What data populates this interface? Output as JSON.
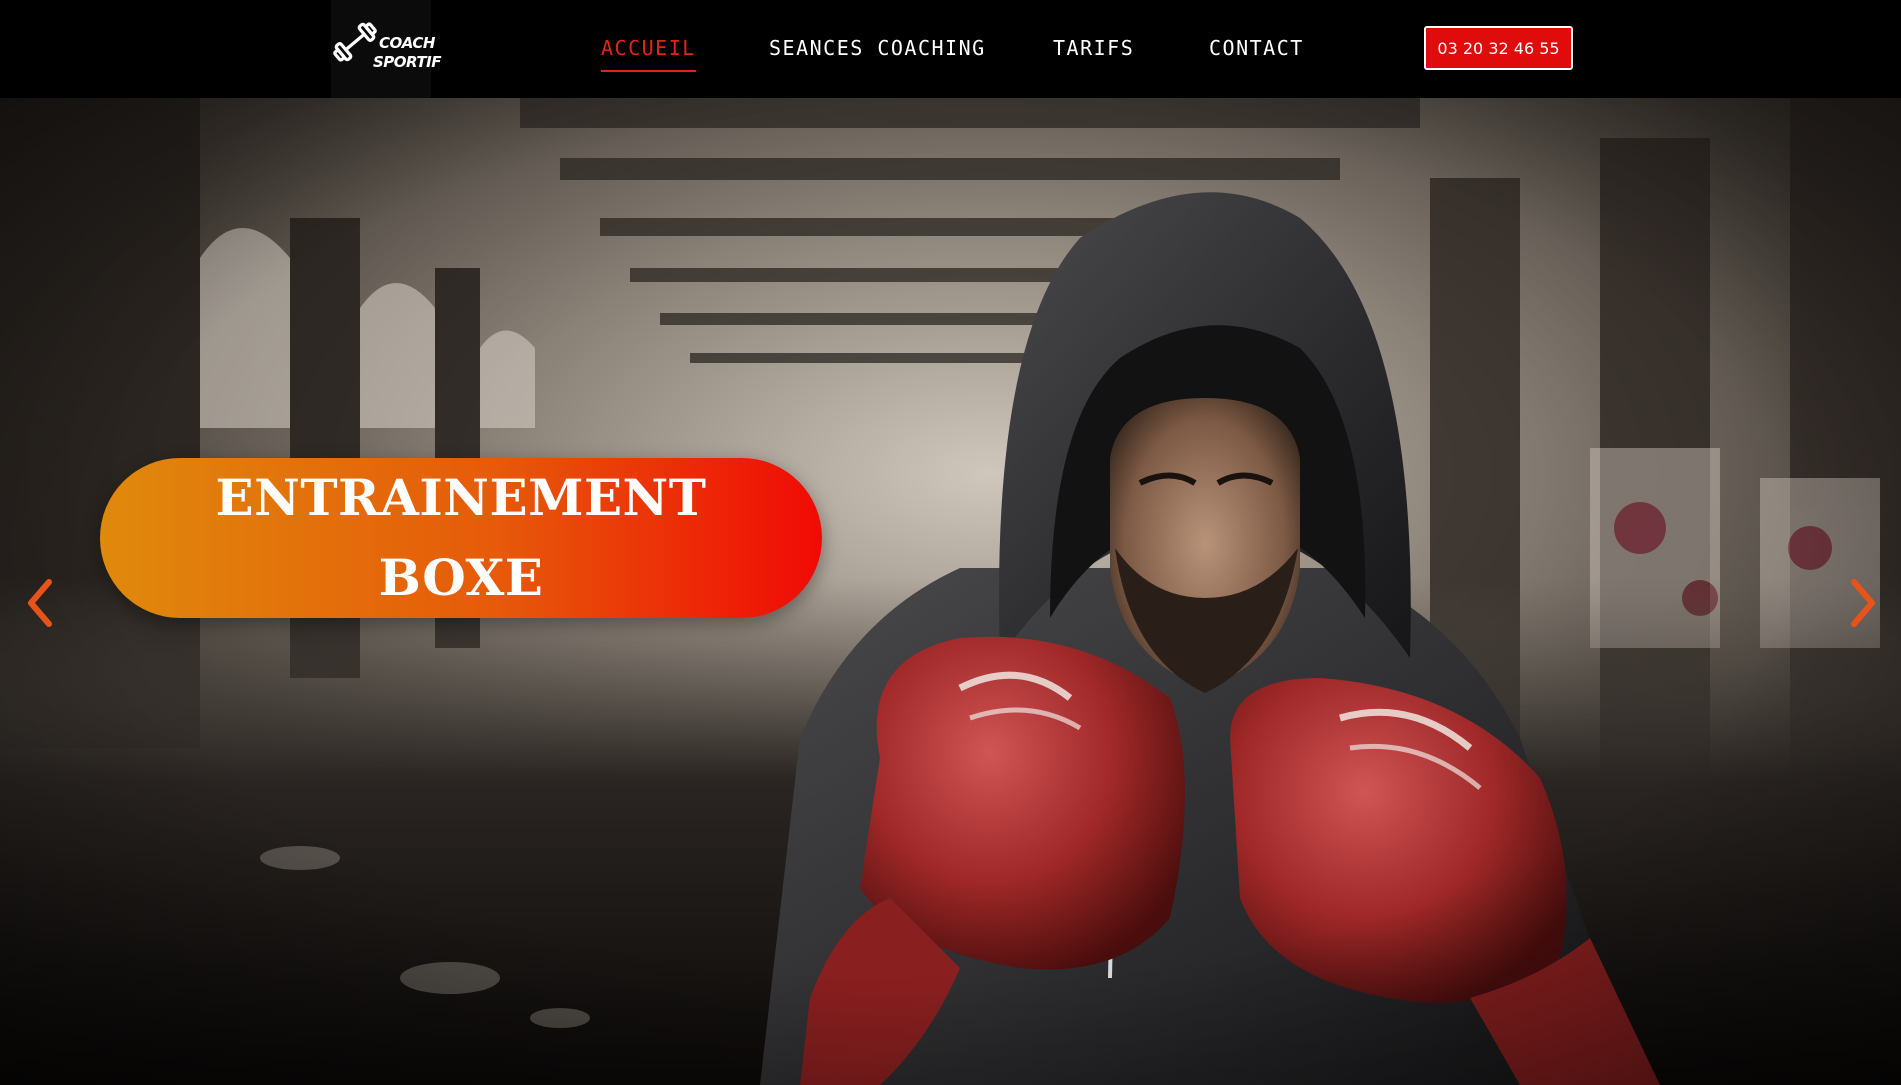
{
  "brand": {
    "logo_line1": "COACH",
    "logo_line2": "SPORTIF",
    "logo_icon": "dumbbell-icon"
  },
  "nav": {
    "items": [
      {
        "label": "ACCUEIL",
        "active": true
      },
      {
        "label": "SEANCES COACHING",
        "active": false
      },
      {
        "label": "TARIFS",
        "active": false
      },
      {
        "label": "CONTACT",
        "active": false
      }
    ]
  },
  "header": {
    "phone": "03 20 32 46 55"
  },
  "hero": {
    "title_line1": "ENTRAINEMENT",
    "title_line2": "BOXE",
    "prev_icon": "chevron-left-icon",
    "next_icon": "chevron-right-icon",
    "image_subject": "boxer-in-hoodie-with-red-gloves"
  },
  "colors": {
    "accent": "#e2231a",
    "phone_bg": "#e00b0b",
    "pill_start": "#df8a0c",
    "pill_end": "#f00a05",
    "arrow": "#e8531a"
  }
}
